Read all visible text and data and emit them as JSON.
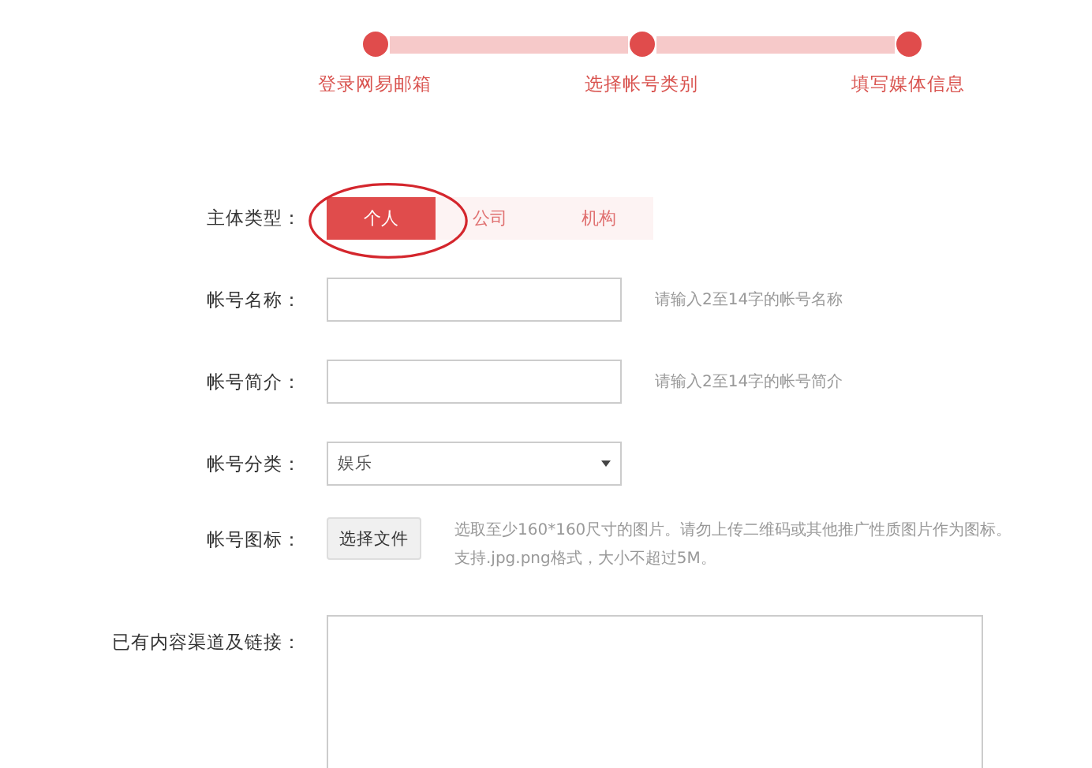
{
  "steps": [
    {
      "label": "登录网易邮箱",
      "done": true
    },
    {
      "label": "选择帐号类别",
      "done": true
    },
    {
      "label": "填写媒体信息",
      "done": true
    }
  ],
  "subject_type": {
    "label": "主体类型：",
    "options": [
      {
        "label": "个人",
        "selected": true
      },
      {
        "label": "公司",
        "selected": false
      },
      {
        "label": "机构",
        "selected": false
      }
    ]
  },
  "fields": [
    {
      "kind": "text",
      "label": "帐号名称：",
      "hint": "请输入2至14字的帐号名称"
    },
    {
      "kind": "text",
      "label": "帐号简介：",
      "hint": "请输入2至14字的帐号简介"
    },
    {
      "kind": "select",
      "label": "帐号分类：",
      "value": "娱乐"
    },
    {
      "kind": "file",
      "label": "帐号图标：",
      "button": "选择文件",
      "hint_lines": [
        "选取至少160*160尺寸的图片。请勿上传二维码或其他推广性质图片作为图标。",
        "支持.jpg.png格式，大小不超过5M。"
      ]
    },
    {
      "kind": "textarea",
      "label": "已有内容渠道及链接："
    }
  ]
}
